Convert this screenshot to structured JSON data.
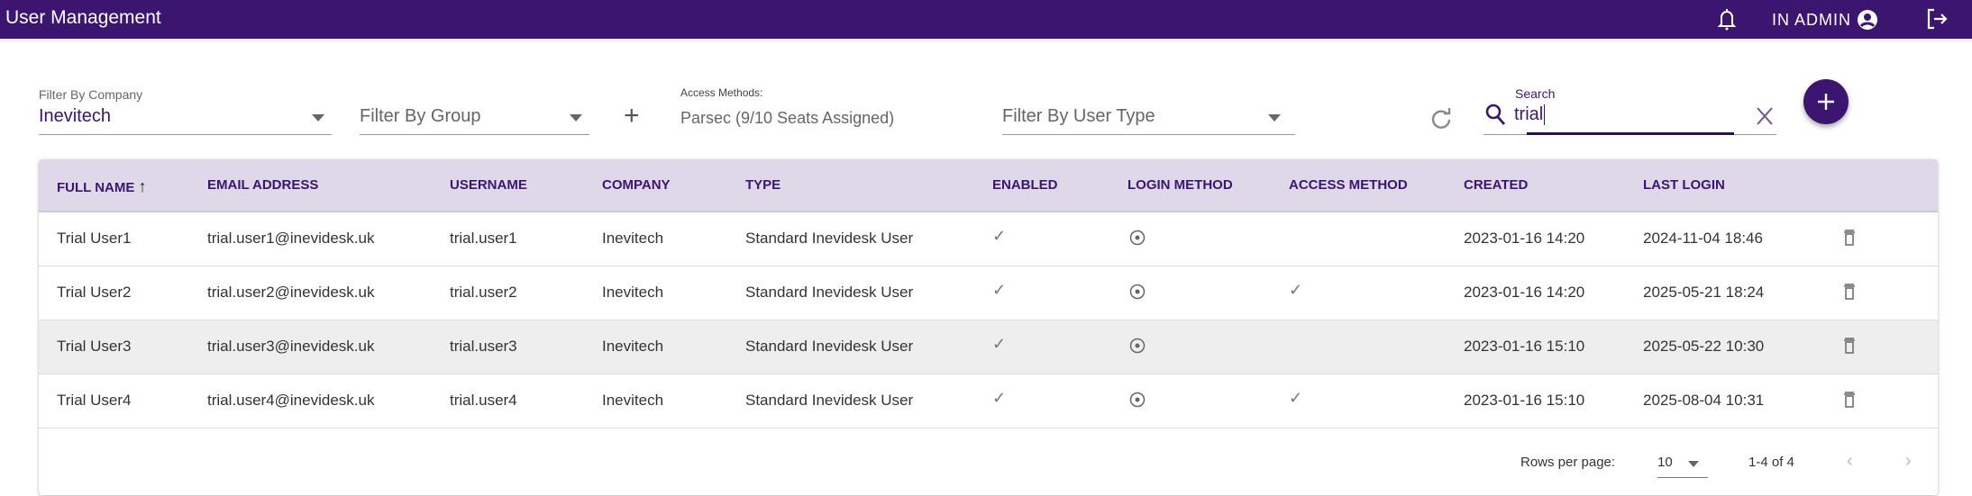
{
  "header": {
    "title": "User Management",
    "user_label": "IN ADMIN"
  },
  "filters": {
    "company_label": "Filter By Company",
    "company_value": "Inevitech",
    "group_placeholder": "Filter By Group",
    "access_methods_label": "Access Methods:",
    "access_methods_value": "Parsec (9/10 Seats Assigned)",
    "user_type_placeholder": "Filter By User Type",
    "search_label": "Search",
    "search_value": "trial"
  },
  "table": {
    "columns": [
      "FULL NAME",
      "EMAIL ADDRESS",
      "USERNAME",
      "COMPANY",
      "TYPE",
      "ENABLED",
      "LOGIN METHOD",
      "ACCESS METHOD",
      "CREATED",
      "LAST LOGIN"
    ],
    "rows": [
      {
        "name": "Trial User1",
        "email": "trial.user1@inevidesk.uk",
        "username": "trial.user1",
        "company": "Inevitech",
        "type": "Standard Inevidesk User",
        "enabled": true,
        "access": false,
        "created": "2023-01-16 14:20",
        "last_login": "2024-11-04 18:46"
      },
      {
        "name": "Trial User2",
        "email": "trial.user2@inevidesk.uk",
        "username": "trial.user2",
        "company": "Inevitech",
        "type": "Standard Inevidesk User",
        "enabled": true,
        "access": true,
        "created": "2023-01-16 14:20",
        "last_login": "2025-05-21 18:24"
      },
      {
        "name": "Trial User3",
        "email": "trial.user3@inevidesk.uk",
        "username": "trial.user3",
        "company": "Inevitech",
        "type": "Standard Inevidesk User",
        "enabled": true,
        "access": false,
        "created": "2023-01-16 15:10",
        "last_login": "2025-05-22 10:30"
      },
      {
        "name": "Trial User4",
        "email": "trial.user4@inevidesk.uk",
        "username": "trial.user4",
        "company": "Inevitech",
        "type": "Standard Inevidesk User",
        "enabled": true,
        "access": true,
        "created": "2023-01-16 15:10",
        "last_login": "2025-08-04 10:31"
      }
    ],
    "footer": {
      "rows_per_page_label": "Rows per page:",
      "rows_per_page": "10",
      "range": "1-4 of 4"
    }
  },
  "colors": {
    "brand": "#3b1570",
    "header_bg": "#dfd8e8"
  }
}
